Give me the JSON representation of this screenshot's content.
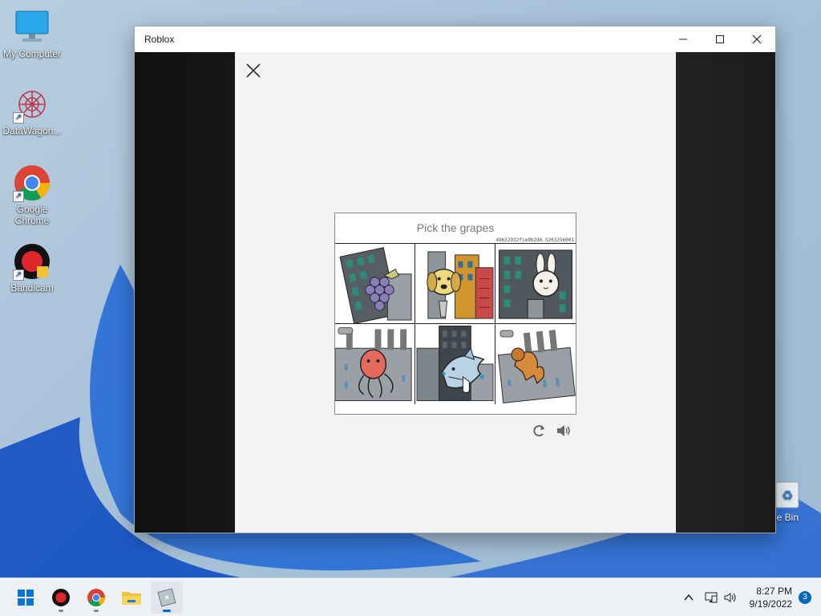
{
  "desktop": {
    "icons": [
      {
        "label": "My Computer",
        "icon": "monitor-icon"
      },
      {
        "label": "DataWagon...",
        "icon": "datawagon-icon"
      },
      {
        "label": "Google Chrome",
        "icon": "chrome-icon"
      },
      {
        "label": "Bandicam",
        "icon": "bandicam-icon"
      }
    ],
    "recycle_bin_label": "cle Bin"
  },
  "window": {
    "title": "Roblox",
    "minimize_glyph": "—",
    "maximize_glyph": "☐",
    "close_glyph": "✕"
  },
  "captcha": {
    "prompt": "Pick the grapes",
    "session_id": "49632932fce0b2d6.5263256001",
    "tiles": [
      {
        "name": "grapes",
        "icon": "grapes-icon"
      },
      {
        "name": "dog",
        "icon": "dog-icon"
      },
      {
        "name": "rabbit",
        "icon": "rabbit-icon"
      },
      {
        "name": "octopus",
        "icon": "octopus-icon"
      },
      {
        "name": "shark",
        "icon": "shark-icon"
      },
      {
        "name": "lion",
        "icon": "lion-icon"
      }
    ],
    "reload_icon": "reload-icon",
    "audio_icon": "speaker-icon"
  },
  "taskbar": {
    "apps": [
      "start-icon",
      "bandicam-icon",
      "chrome-icon",
      "file-explorer-icon",
      "roblox-icon"
    ],
    "tray": {
      "time": "8:27 PM",
      "date": "9/19/2022",
      "notification_count": "3"
    }
  },
  "colors": {
    "accent": "#0067c0",
    "modal_bg": "#f3f4f6"
  }
}
